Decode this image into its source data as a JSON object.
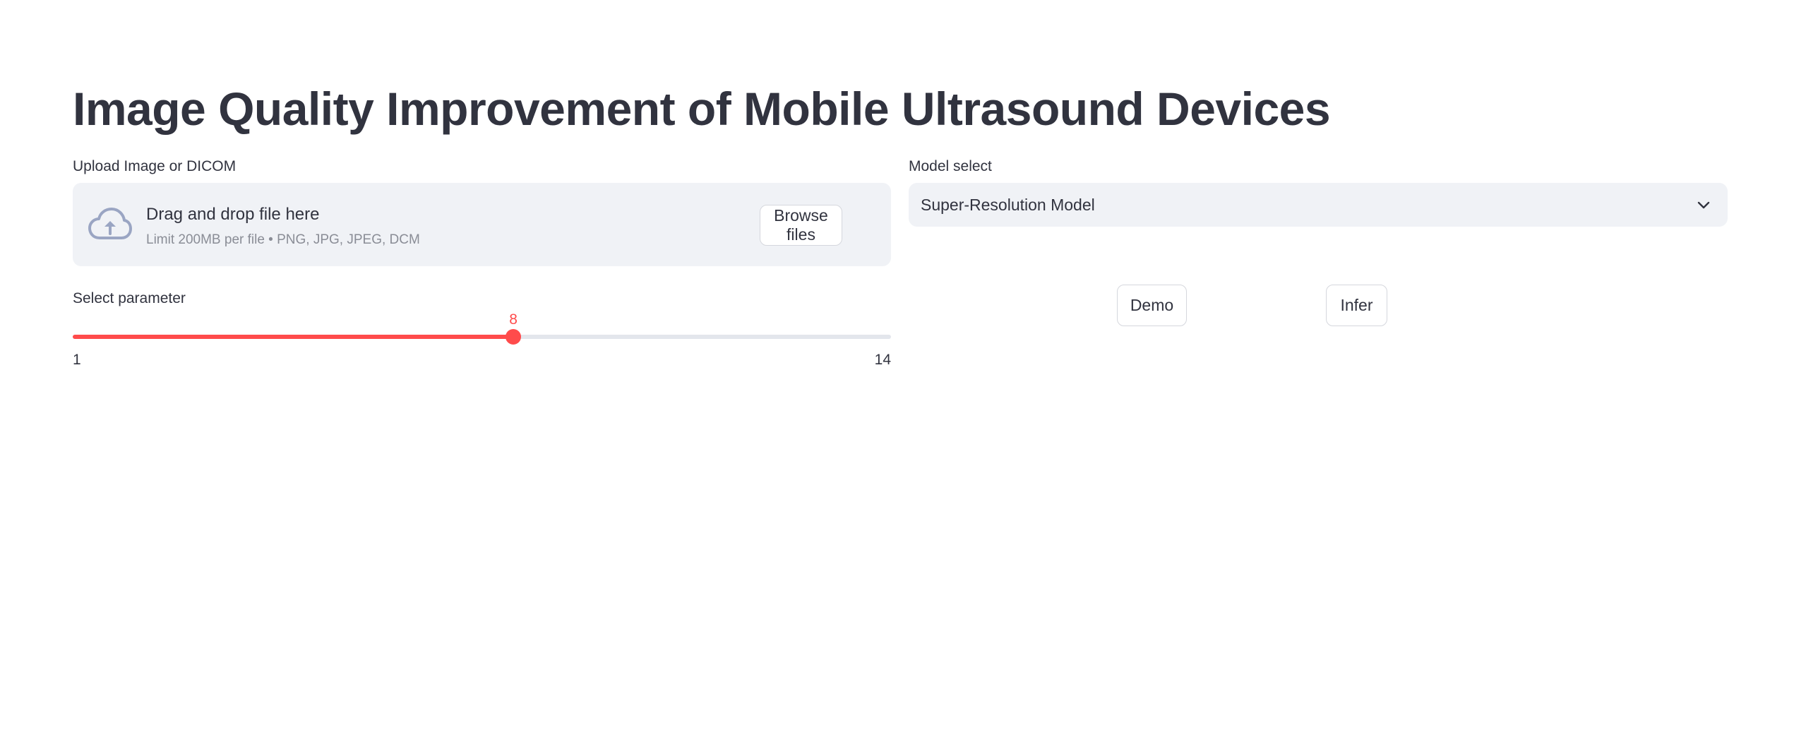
{
  "header": {
    "title": "Image Quality Improvement of Mobile Ultrasound Devices"
  },
  "upload": {
    "label": "Upload Image or DICOM",
    "drop_text": "Drag and drop file here",
    "limit_text": "Limit 200MB per file • PNG, JPG, JPEG, DCM",
    "browse_label": "Browse files",
    "icon": "cloud-upload-icon"
  },
  "model": {
    "label": "Model select",
    "selected": "Super-Resolution Model",
    "icon": "chevron-down-icon"
  },
  "slider": {
    "label": "Select parameter",
    "value": "8",
    "min": "1",
    "max": "14",
    "accent_color": "#ff4b4b"
  },
  "actions": {
    "demo_label": "Demo",
    "infer_label": "Infer"
  }
}
